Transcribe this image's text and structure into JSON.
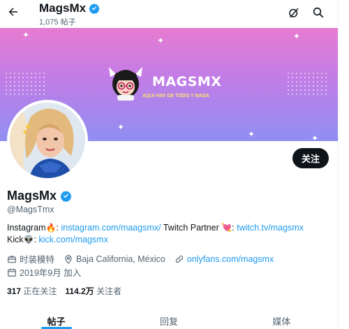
{
  "header": {
    "title": "MagsMx",
    "post_count": "1,075 帖子"
  },
  "banner": {
    "logo_text": "MAGSMX",
    "tagline": "AQUI HAY DE TODO Y NADA"
  },
  "profile": {
    "name": "MagsMx",
    "handle": "@MagsTmx",
    "follow_label": "关注",
    "bio": {
      "line1_prefix": "Instagram",
      "line1_colon": ": ",
      "instagram_link": "instagram.com/maagsmx/",
      "twitch_prefix": " Twitch Partner ",
      "twitch_colon": ": ",
      "twitch_link": "twitch.tv/magsmx",
      "kick_prefix": "Kick",
      "kick_colon": ": ",
      "kick_link": "kick.com/magsmx"
    },
    "category": "时装模特",
    "location": "Baja California, México",
    "website": "onlyfans.com/magsmx",
    "joined": "2019年9月 加入",
    "following_count": "317",
    "following_label": "正在关注",
    "followers_count": "114.2万",
    "followers_label": "关注者"
  },
  "tabs": [
    {
      "label": "帖子",
      "active": true
    },
    {
      "label": "回复",
      "active": false
    },
    {
      "label": "媒体",
      "active": false
    }
  ],
  "colors": {
    "accent": "#1d9bf0",
    "text": "#0f1419",
    "muted": "#536471"
  }
}
